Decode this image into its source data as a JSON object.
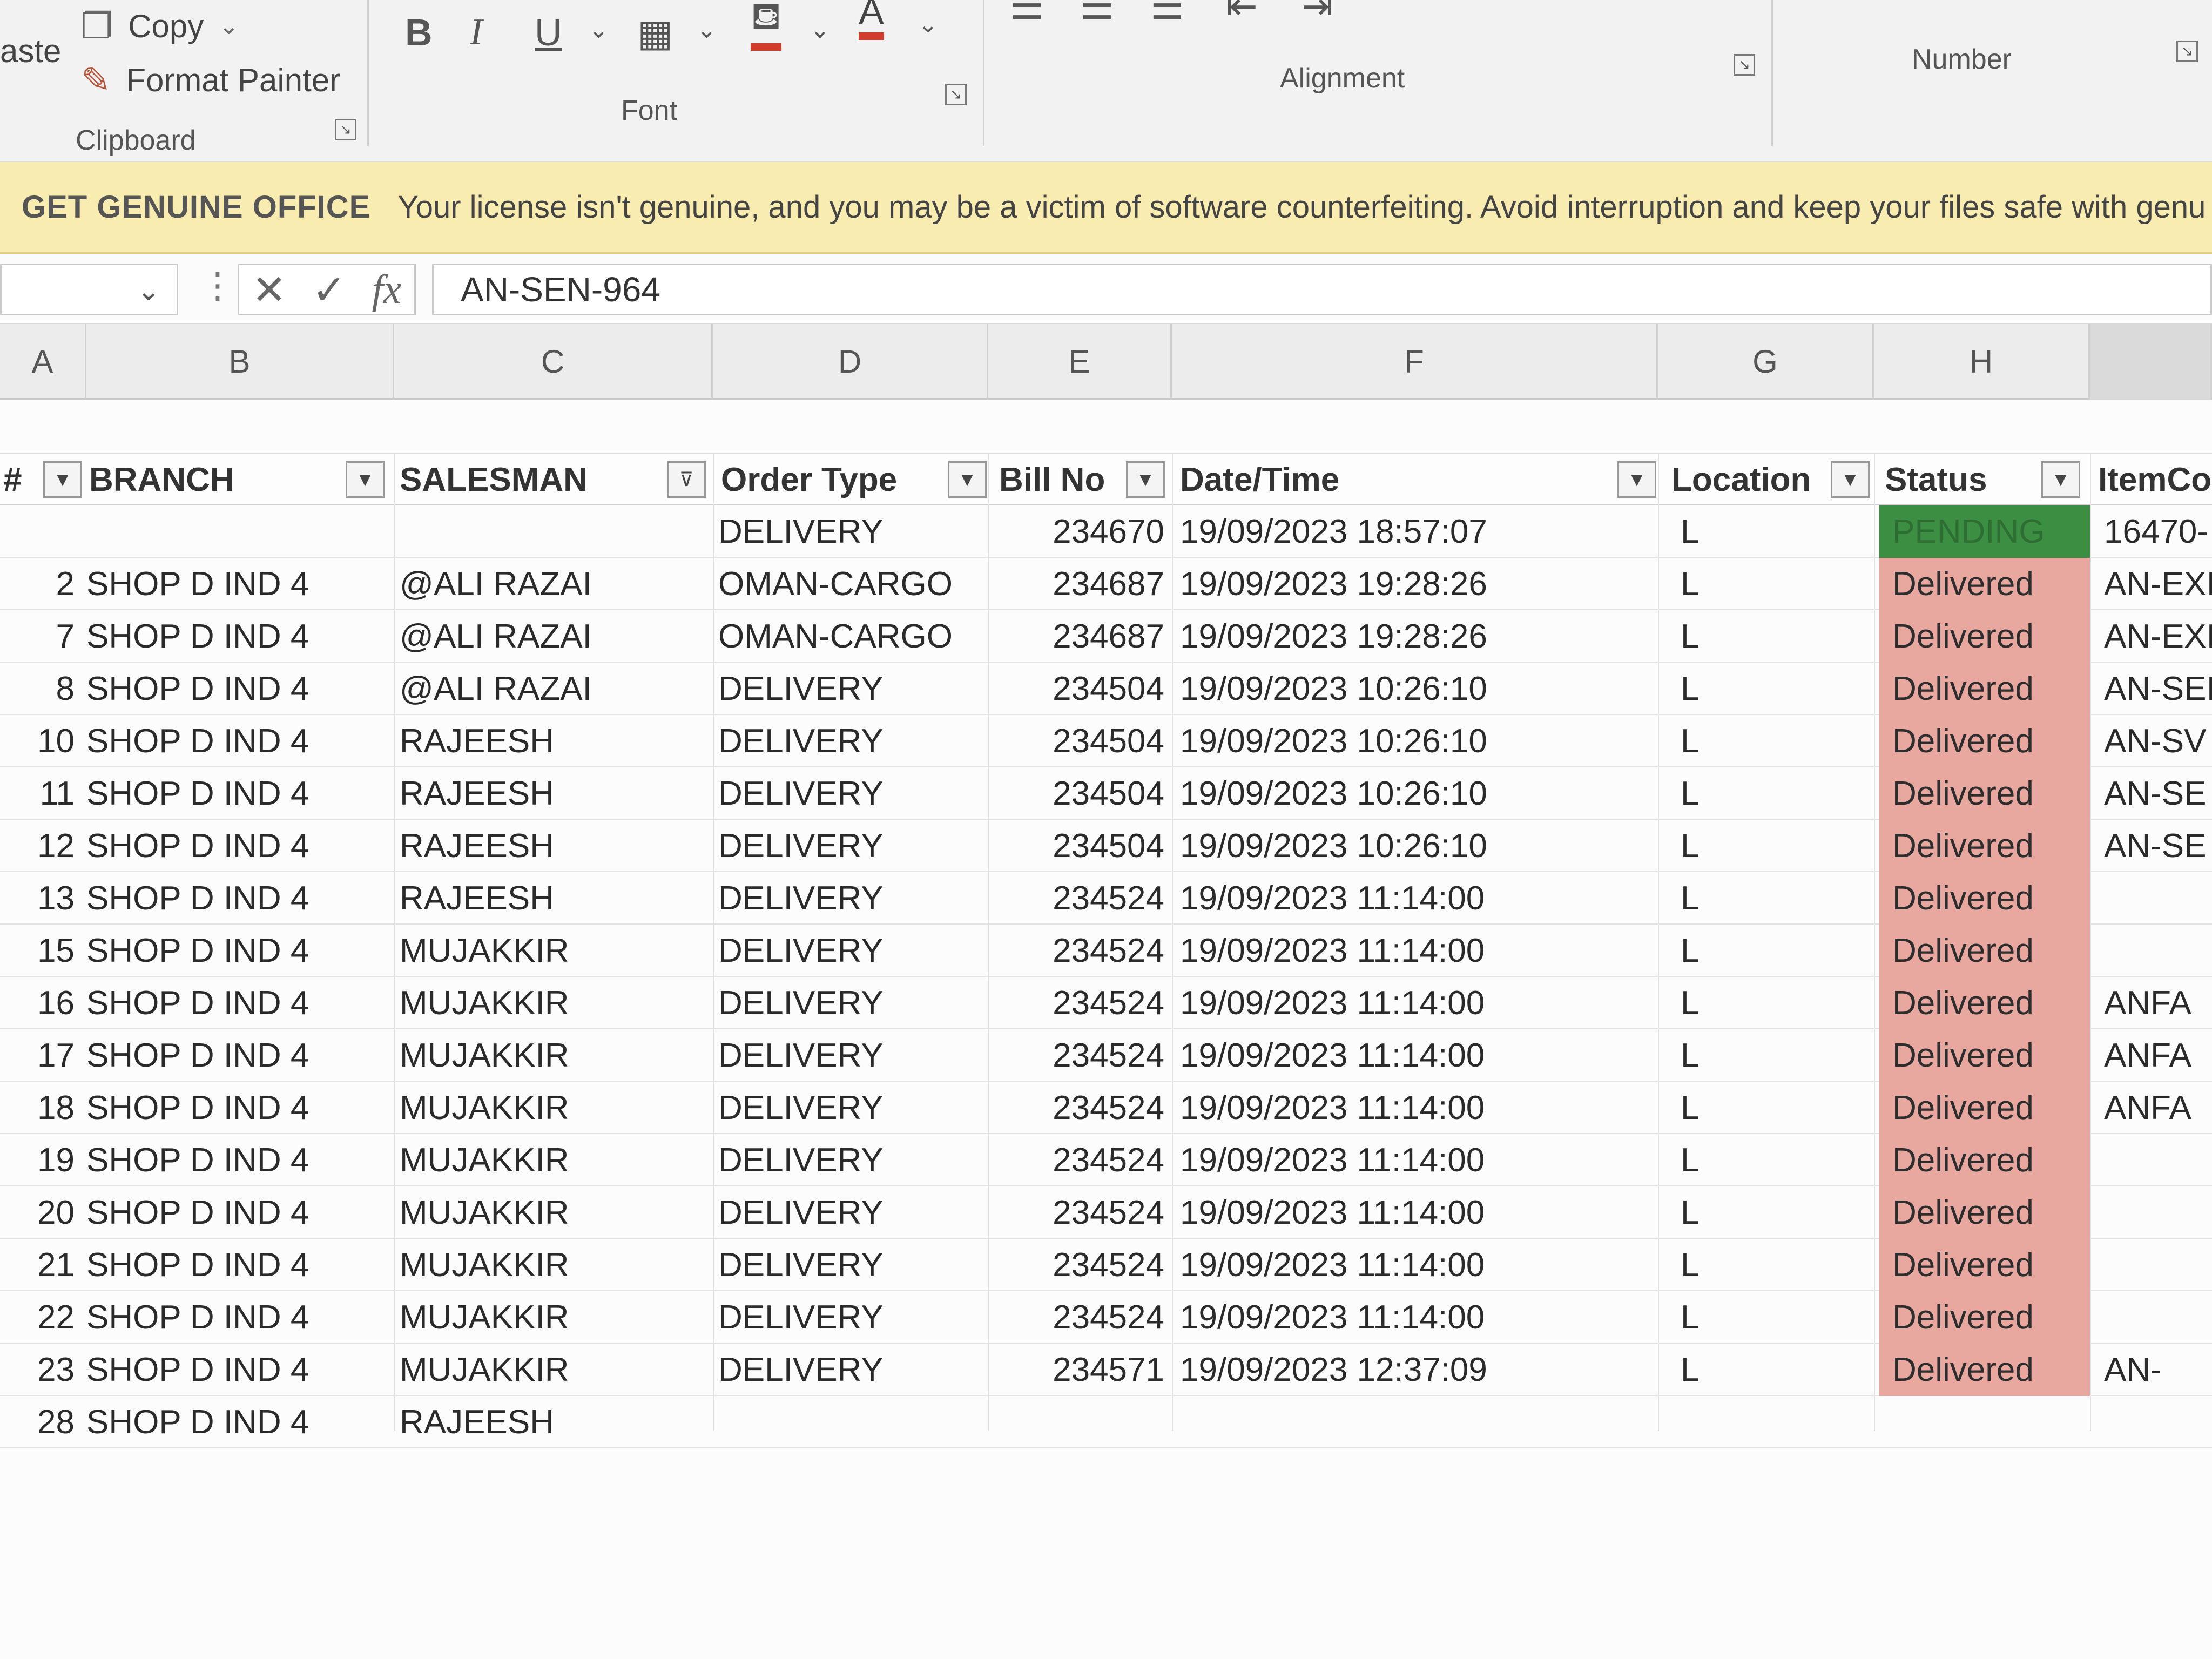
{
  "ribbon": {
    "clipboard": {
      "paste_label": "aste",
      "copy_label": "Copy",
      "format_painter_label": "Format Painter",
      "group_label": "Clipboard"
    },
    "font": {
      "bold_glyph": "B",
      "italic_glyph": "I",
      "underline_glyph": "U",
      "group_label": "Font"
    },
    "alignment": {
      "group_label": "Alignment"
    },
    "number": {
      "group_label": "Number"
    }
  },
  "banner": {
    "tag": "GET GENUINE OFFICE",
    "message": "Your license isn't genuine, and you may be a victim of software counterfeiting. Avoid interruption and keep your files safe with genu"
  },
  "formula_bar": {
    "name_box_value": "",
    "cancel_glyph": "✕",
    "enter_glyph": "✓",
    "fx_glyph": "fx",
    "value": "AN-SEN-964"
  },
  "columns": [
    "A",
    "B",
    "C",
    "D",
    "E",
    "F",
    "G",
    "H"
  ],
  "table": {
    "headers": {
      "num": "#",
      "branch": "BRANCH",
      "salesman": "SALESMAN",
      "order_type": "Order Type",
      "bill_no": "Bill No",
      "datetime": "Date/Time",
      "location": "Location",
      "status": "Status",
      "item_code": "ItemCo"
    },
    "rows": [
      {
        "num": "",
        "branch": "",
        "salesman": "",
        "order": "DELIVERY",
        "bill": "234670",
        "date": "19/09/2023 18:57:07",
        "loc": "L",
        "status": "PENDING",
        "item": "16470-"
      },
      {
        "num": "2",
        "branch": "SHOP D IND 4",
        "salesman": "@ALI RAZAI",
        "order": "OMAN-CARGO",
        "bill": "234687",
        "date": "19/09/2023 19:28:26",
        "loc": "L",
        "status": "Delivered",
        "item": "AN-EXI"
      },
      {
        "num": "7",
        "branch": "SHOP D IND 4",
        "salesman": "@ALI RAZAI",
        "order": "OMAN-CARGO",
        "bill": "234687",
        "date": "19/09/2023 19:28:26",
        "loc": "L",
        "status": "Delivered",
        "item": "AN-EXI"
      },
      {
        "num": "8",
        "branch": "SHOP D IND 4",
        "salesman": "@ALI RAZAI",
        "order": "DELIVERY",
        "bill": "234504",
        "date": "19/09/2023 10:26:10",
        "loc": "L",
        "status": "Delivered",
        "item": "AN-SEI"
      },
      {
        "num": "10",
        "branch": "SHOP D IND 4",
        "salesman": "RAJEESH",
        "order": "DELIVERY",
        "bill": "234504",
        "date": "19/09/2023 10:26:10",
        "loc": "L",
        "status": "Delivered",
        "item": "AN-SV"
      },
      {
        "num": "11",
        "branch": "SHOP D IND 4",
        "salesman": "RAJEESH",
        "order": "DELIVERY",
        "bill": "234504",
        "date": "19/09/2023 10:26:10",
        "loc": "L",
        "status": "Delivered",
        "item": "AN-SE"
      },
      {
        "num": "12",
        "branch": "SHOP D IND 4",
        "salesman": "RAJEESH",
        "order": "DELIVERY",
        "bill": "234504",
        "date": "19/09/2023 10:26:10",
        "loc": "L",
        "status": "Delivered",
        "item": "AN-SE"
      },
      {
        "num": "13",
        "branch": "SHOP D IND 4",
        "salesman": "RAJEESH",
        "order": "DELIVERY",
        "bill": "234524",
        "date": "19/09/2023 11:14:00",
        "loc": "L",
        "status": "Delivered",
        "item": ""
      },
      {
        "num": "15",
        "branch": "SHOP D IND 4",
        "salesman": "MUJAKKIR",
        "order": "DELIVERY",
        "bill": "234524",
        "date": "19/09/2023 11:14:00",
        "loc": "L",
        "status": "Delivered",
        "item": ""
      },
      {
        "num": "16",
        "branch": "SHOP D IND 4",
        "salesman": "MUJAKKIR",
        "order": "DELIVERY",
        "bill": "234524",
        "date": "19/09/2023 11:14:00",
        "loc": "L",
        "status": "Delivered",
        "item": "ANFA"
      },
      {
        "num": "17",
        "branch": "SHOP D IND 4",
        "salesman": "MUJAKKIR",
        "order": "DELIVERY",
        "bill": "234524",
        "date": "19/09/2023 11:14:00",
        "loc": "L",
        "status": "Delivered",
        "item": "ANFA"
      },
      {
        "num": "18",
        "branch": "SHOP D IND 4",
        "salesman": "MUJAKKIR",
        "order": "DELIVERY",
        "bill": "234524",
        "date": "19/09/2023 11:14:00",
        "loc": "L",
        "status": "Delivered",
        "item": "ANFA"
      },
      {
        "num": "19",
        "branch": "SHOP D IND 4",
        "salesman": "MUJAKKIR",
        "order": "DELIVERY",
        "bill": "234524",
        "date": "19/09/2023 11:14:00",
        "loc": "L",
        "status": "Delivered",
        "item": ""
      },
      {
        "num": "20",
        "branch": "SHOP D IND 4",
        "salesman": "MUJAKKIR",
        "order": "DELIVERY",
        "bill": "234524",
        "date": "19/09/2023 11:14:00",
        "loc": "L",
        "status": "Delivered",
        "item": ""
      },
      {
        "num": "21",
        "branch": "SHOP D IND 4",
        "salesman": "MUJAKKIR",
        "order": "DELIVERY",
        "bill": "234524",
        "date": "19/09/2023 11:14:00",
        "loc": "L",
        "status": "Delivered",
        "item": ""
      },
      {
        "num": "22",
        "branch": "SHOP D IND 4",
        "salesman": "MUJAKKIR",
        "order": "DELIVERY",
        "bill": "234524",
        "date": "19/09/2023 11:14:00",
        "loc": "L",
        "status": "Delivered",
        "item": ""
      },
      {
        "num": "23",
        "branch": "SHOP D IND 4",
        "salesman": "MUJAKKIR",
        "order": "DELIVERY",
        "bill": "234571",
        "date": "19/09/2023 12:37:09",
        "loc": "L",
        "status": "Delivered",
        "item": "AN-"
      },
      {
        "num": "28",
        "branch": "SHOP D IND 4",
        "salesman": "RAJEESH",
        "order": "",
        "bill": "",
        "date": "",
        "loc": "",
        "status": "",
        "item": ""
      }
    ]
  },
  "colors": {
    "delivered_fill": "#e8a79f",
    "pending_fill": "#3c8e43",
    "banner_fill": "#f8ecb0"
  }
}
